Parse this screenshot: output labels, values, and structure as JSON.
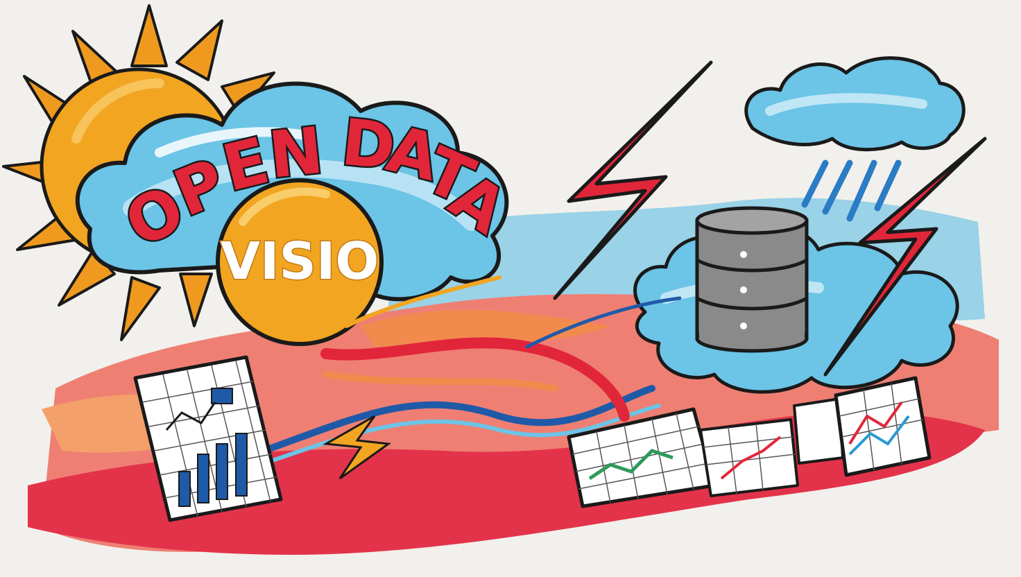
{
  "illustration": {
    "title": "OPEN DATA",
    "subtitle": "VISIO"
  },
  "colors": {
    "background": "#f2f0ec",
    "sun": "#f2a521",
    "sun_ray": "#ef9a1f",
    "cloud": "#6cc4e6",
    "cloud_light": "#bfe6f5",
    "bolt": "#e2263a",
    "wave_red": "#e23a43",
    "wave_orange": "#f28a4e",
    "wave_pink": "#ef7a72",
    "database": "#8a8a8a",
    "chart_blue": "#1f5aa8",
    "outline": "#1a1a1a"
  },
  "icons": [
    "sun-icon",
    "cloud-icon",
    "lightning-bolt-icon",
    "database-icon",
    "rain-icon",
    "chart-sheet-icon"
  ]
}
